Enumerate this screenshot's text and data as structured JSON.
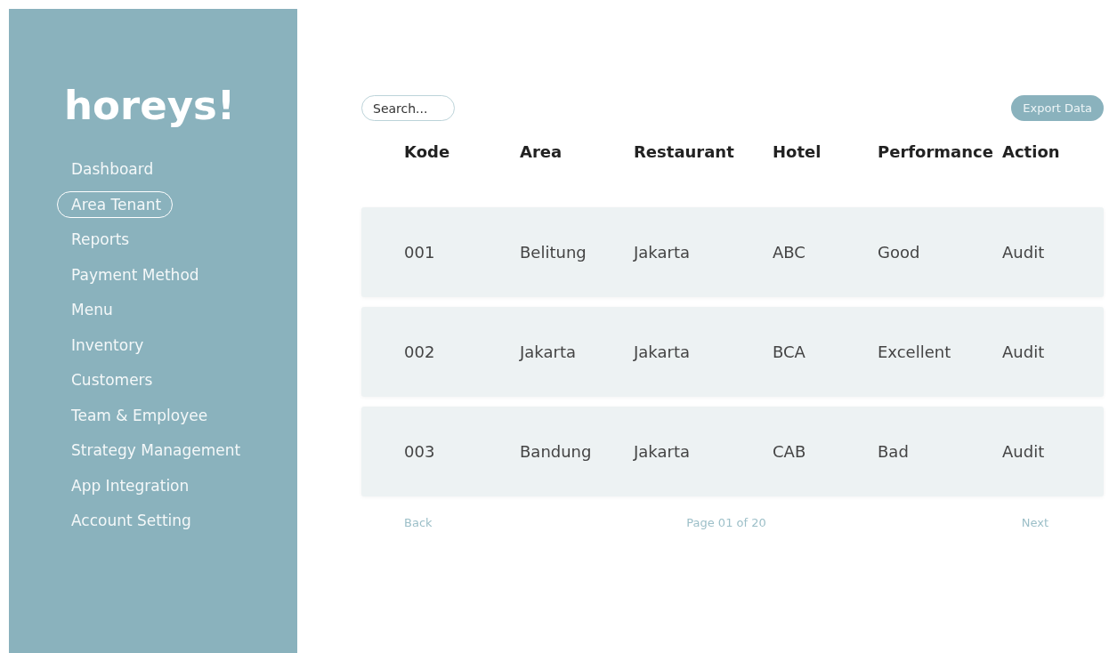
{
  "sidebar": {
    "logo": "horeys!",
    "items": [
      {
        "label": "Dashboard",
        "selected": false
      },
      {
        "label": "Area Tenant",
        "selected": true
      },
      {
        "label": "Reports",
        "selected": false
      },
      {
        "label": "Payment Method",
        "selected": false
      },
      {
        "label": "Menu",
        "selected": false
      },
      {
        "label": "Inventory",
        "selected": false
      },
      {
        "label": "Customers",
        "selected": false
      },
      {
        "label": "Team & Employee",
        "selected": false
      },
      {
        "label": "Strategy Management",
        "selected": false
      },
      {
        "label": "App Integration",
        "selected": false
      },
      {
        "label": "Account Setting",
        "selected": false
      }
    ]
  },
  "search": {
    "placeholder": "Search..."
  },
  "export_button": "Export Data",
  "table": {
    "columns": [
      "Kode",
      "Area",
      "Restaurant",
      "Hotel",
      "Performance",
      "Action"
    ],
    "rows": [
      [
        "001",
        "Belitung",
        "Jakarta",
        "ABC",
        "Good",
        "Audit"
      ],
      [
        "002",
        "Jakarta",
        "Jakarta",
        "BCA",
        "Excellent",
        "Audit"
      ],
      [
        "003",
        "Bandung",
        "Jakarta",
        "CAB",
        "Bad",
        "Audit"
      ]
    ]
  },
  "pagination": {
    "back": "Back",
    "page": "Page 01 of 20",
    "next": "Next"
  }
}
